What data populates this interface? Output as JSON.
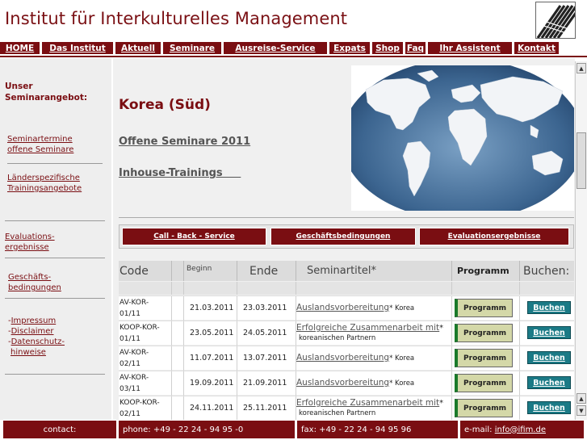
{
  "header": {
    "title": "Institut für Interkulturelles Management",
    "logo": "ifim-logo"
  },
  "nav": [
    {
      "label": "HOME",
      "w": 49
    },
    {
      "label": "Das Institut",
      "w": 88
    },
    {
      "label": "Aktuell",
      "w": 56
    },
    {
      "label": "Seminare",
      "w": 72
    },
    {
      "label": "Ausreise-Service",
      "w": 128
    },
    {
      "label": "Expats",
      "w": 50
    },
    {
      "label": "Shop",
      "w": 38
    },
    {
      "label": "Faq",
      "w": 25
    },
    {
      "label": "Ihr Assistent",
      "w": 104
    },
    {
      "label": "Kontakt",
      "w": 55
    }
  ],
  "sidebar": {
    "heading_1": "Unser",
    "heading_2": "Seminarangebot:",
    "link_1a": "Seminartermine",
    "link_1b": "offene Seminare",
    "link_2a": "Länderspezifische",
    "link_2b": "Trainingsangebote",
    "link_3a": "Evaluations-",
    "link_3b": "ergebnisse",
    "link_4a": "Geschäfts-",
    "link_4b": "bedingungen",
    "link_5": "Impressum",
    "link_6": "Disclaimer",
    "link_7a": "Datenschutz-",
    "link_7b": "hinweise"
  },
  "main": {
    "country": "Korea (Süd)",
    "link_open": "Offene Seminare  2011",
    "link_inhouse": "Inhouse-Trainings     ",
    "btn_callback": "Call - Back - Service",
    "btn_terms": "Geschäftsbedingungen",
    "btn_eval": "Evaluationsergebnisse"
  },
  "table": {
    "h_code": "Code",
    "h_begin": "Beginn",
    "h_end": "Ende",
    "h_title": "Seminartitel*",
    "h_prog": "Programm",
    "h_book": "Buchen:",
    "rows": [
      {
        "code1": "AV-KOR-",
        "code2": "01/11",
        "begin": "21.03.2011",
        "end": "23.03.2011",
        "title": "Auslandsvorbereitung",
        "suffix": "* Korea",
        "inline": true,
        "prog": "Programm",
        "book": "Buchen"
      },
      {
        "code1": "KOOP-KOR-",
        "code2": "01/11",
        "begin": "23.05.2011",
        "end": "24.05.2011",
        "title": "Erfolgreiche Zusammenarbeit mit",
        "suffix": "koreanischen Partnern",
        "inline": false,
        "prog": "Programm",
        "book": "Buchen"
      },
      {
        "code1": "AV-KOR-",
        "code2": "02/11",
        "begin": "11.07.2011",
        "end": "13.07.2011",
        "title": "Auslandsvorbereitung",
        "suffix": "* Korea",
        "inline": true,
        "prog": "Programm",
        "book": "Buchen"
      },
      {
        "code1": "AV-KOR-",
        "code2": "03/11",
        "begin": "19.09.2011",
        "end": "21.09.2011",
        "title": "Auslandsvorbereitung",
        "suffix": "* Korea",
        "inline": true,
        "prog": "Programm",
        "book": "Buchen"
      },
      {
        "code1": "KOOP-KOR-",
        "code2": "02/11",
        "begin": "24.11.2011",
        "end": "25.11.2011",
        "title": "Erfolgreiche Zusammenarbeit mit",
        "suffix": "koreanischen Partnern",
        "inline": false,
        "prog": "Programm",
        "book": "Buchen"
      }
    ]
  },
  "footer": {
    "contact": "contact:",
    "phone": "phone: +49 - 22 24 - 94 95 -0",
    "fax": "fax: +49 - 22 24 - 94 95 96",
    "email_label": "e-mail: ",
    "email": "info@ifim.de"
  },
  "colors": {
    "brand": "#7a0e12",
    "book": "#1b7a86"
  }
}
